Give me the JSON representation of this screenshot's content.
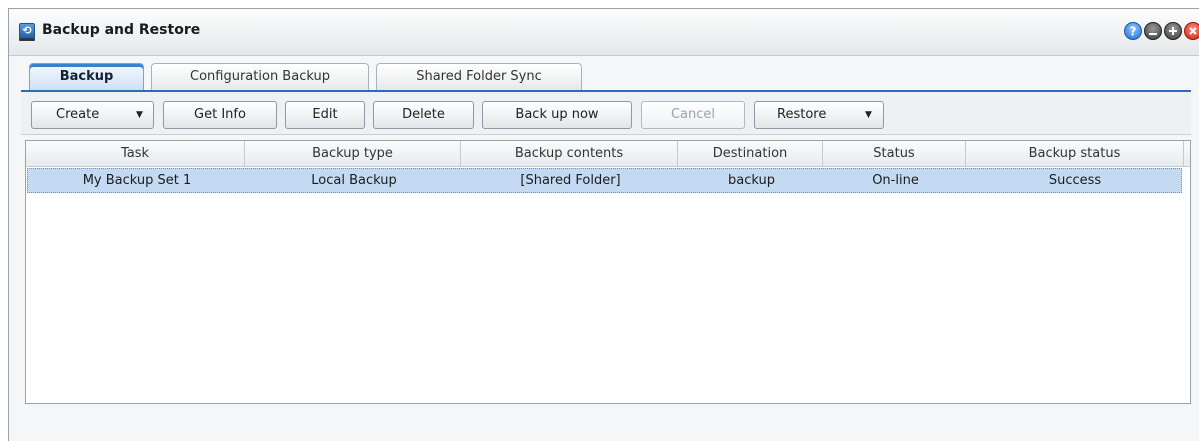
{
  "window": {
    "title": "Backup and Restore",
    "icons": [
      "app-backup-icon",
      "help-icon",
      "minimize-icon",
      "maximize-icon",
      "close-icon"
    ]
  },
  "tabs": [
    {
      "label": "Backup",
      "active": true
    },
    {
      "label": "Configuration Backup",
      "active": false
    },
    {
      "label": "Shared Folder Sync",
      "active": false
    }
  ],
  "toolbar": {
    "create": "Create",
    "get_info": "Get Info",
    "edit": "Edit",
    "delete": "Delete",
    "back_up_now": "Back up now",
    "cancel": "Cancel",
    "restore": "Restore"
  },
  "table": {
    "columns": [
      "Task",
      "Backup type",
      "Backup contents",
      "Destination",
      "Status",
      "Backup status"
    ],
    "rows": [
      [
        "My Backup Set 1",
        "Local Backup",
        "[Shared Folder]",
        "backup",
        "On-line",
        "Success"
      ]
    ],
    "selected_row": 0
  },
  "colors": {
    "accent": "#2e6db6",
    "selection": "#c4daf3",
    "close": "#d11f10",
    "help": "#1f6fd1"
  }
}
